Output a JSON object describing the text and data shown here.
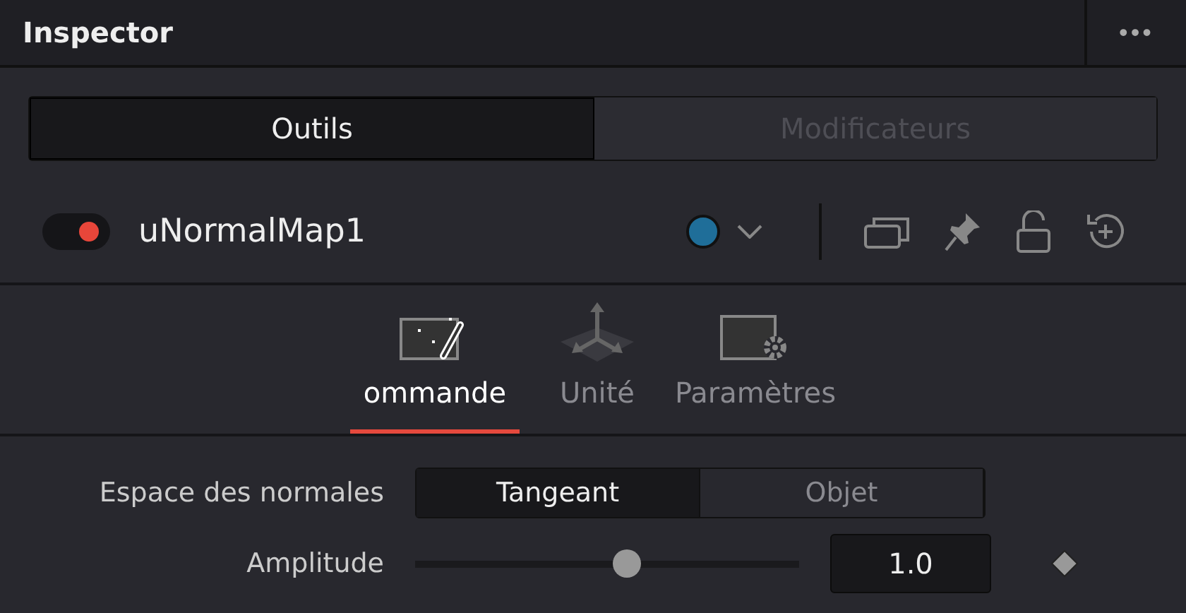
{
  "header": {
    "title": "Inspector",
    "menu": "•••"
  },
  "mode_tabs": [
    {
      "label": "Outils",
      "selected": true
    },
    {
      "label": "Modificateurs",
      "selected": false
    }
  ],
  "node": {
    "enabled": true,
    "name": "uNormalMap1",
    "color": "#1f6e99"
  },
  "tool_tabs": [
    {
      "label": "ommande",
      "kind": "controls",
      "selected": true
    },
    {
      "label": "Unité",
      "kind": "unit",
      "selected": false
    },
    {
      "label": "Paramètres",
      "kind": "settings",
      "selected": false
    }
  ],
  "controls": [
    {
      "kind": "choice",
      "label": "Espace des normales",
      "options": [
        {
          "label": "Tangeant",
          "selected": true
        },
        {
          "label": "Objet",
          "selected": false
        }
      ]
    },
    {
      "kind": "slider",
      "label": "Amplitude",
      "level": 0.55,
      "value": "1.0"
    }
  ]
}
